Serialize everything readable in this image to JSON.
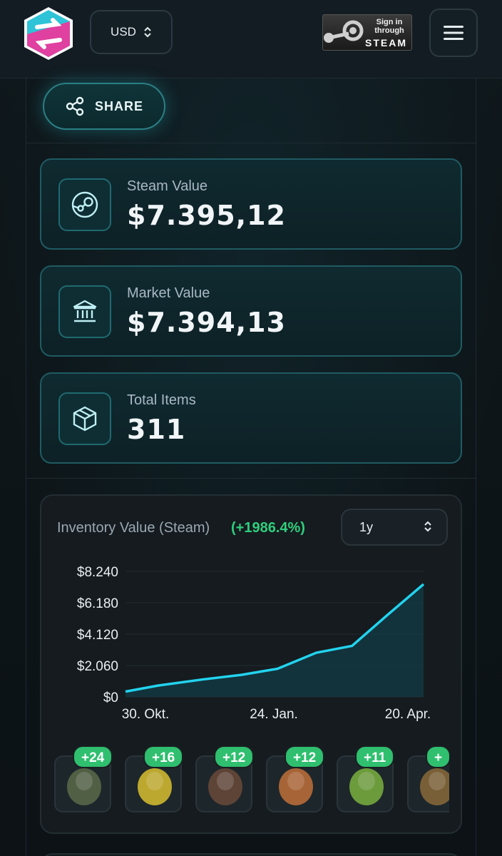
{
  "header": {
    "currency": "USD",
    "steam_signin_line1": "Sign in",
    "steam_signin_line2": "through",
    "steam_signin_brand": "STEAM"
  },
  "share": {
    "label": "SHARE"
  },
  "stats": [
    {
      "label": "Steam Value",
      "value": "$7.395,12",
      "icon": "steam-icon"
    },
    {
      "label": "Market Value",
      "value": "$7.394,13",
      "icon": "bank-icon"
    },
    {
      "label": "Total Items",
      "value": "311",
      "icon": "box-icon"
    }
  ],
  "chart_section": {
    "title": "Inventory Value (Steam)",
    "change": "(+1986.4%)",
    "range": "1y"
  },
  "chart_data": {
    "type": "area",
    "title": "Inventory Value (Steam)",
    "x_tick_labels": [
      "30. Okt.",
      "24. Jan.",
      "20. Apr."
    ],
    "y_tick_labels": [
      "$8.240",
      "$6.180",
      "$4.120",
      "$2.060",
      "$0"
    ],
    "ylim": [
      0,
      8240
    ],
    "series": [
      {
        "values": [
          350,
          750,
          1150,
          1450,
          1850,
          2900,
          3350,
          5400,
          7400
        ]
      }
    ],
    "colors": {
      "line": "#22d3ee",
      "fill": "#123a44"
    },
    "grid": true
  },
  "items": [
    {
      "badge": "+24",
      "name": "soldier-with-cap"
    },
    {
      "badge": "+16",
      "name": "yellow-helmet"
    },
    {
      "badge": "+12",
      "name": "mohawk-head"
    },
    {
      "badge": "+12",
      "name": "orange-vest"
    },
    {
      "badge": "+11",
      "name": "specimen-jar"
    },
    {
      "badge": "+",
      "name": "striped-shirt"
    }
  ]
}
